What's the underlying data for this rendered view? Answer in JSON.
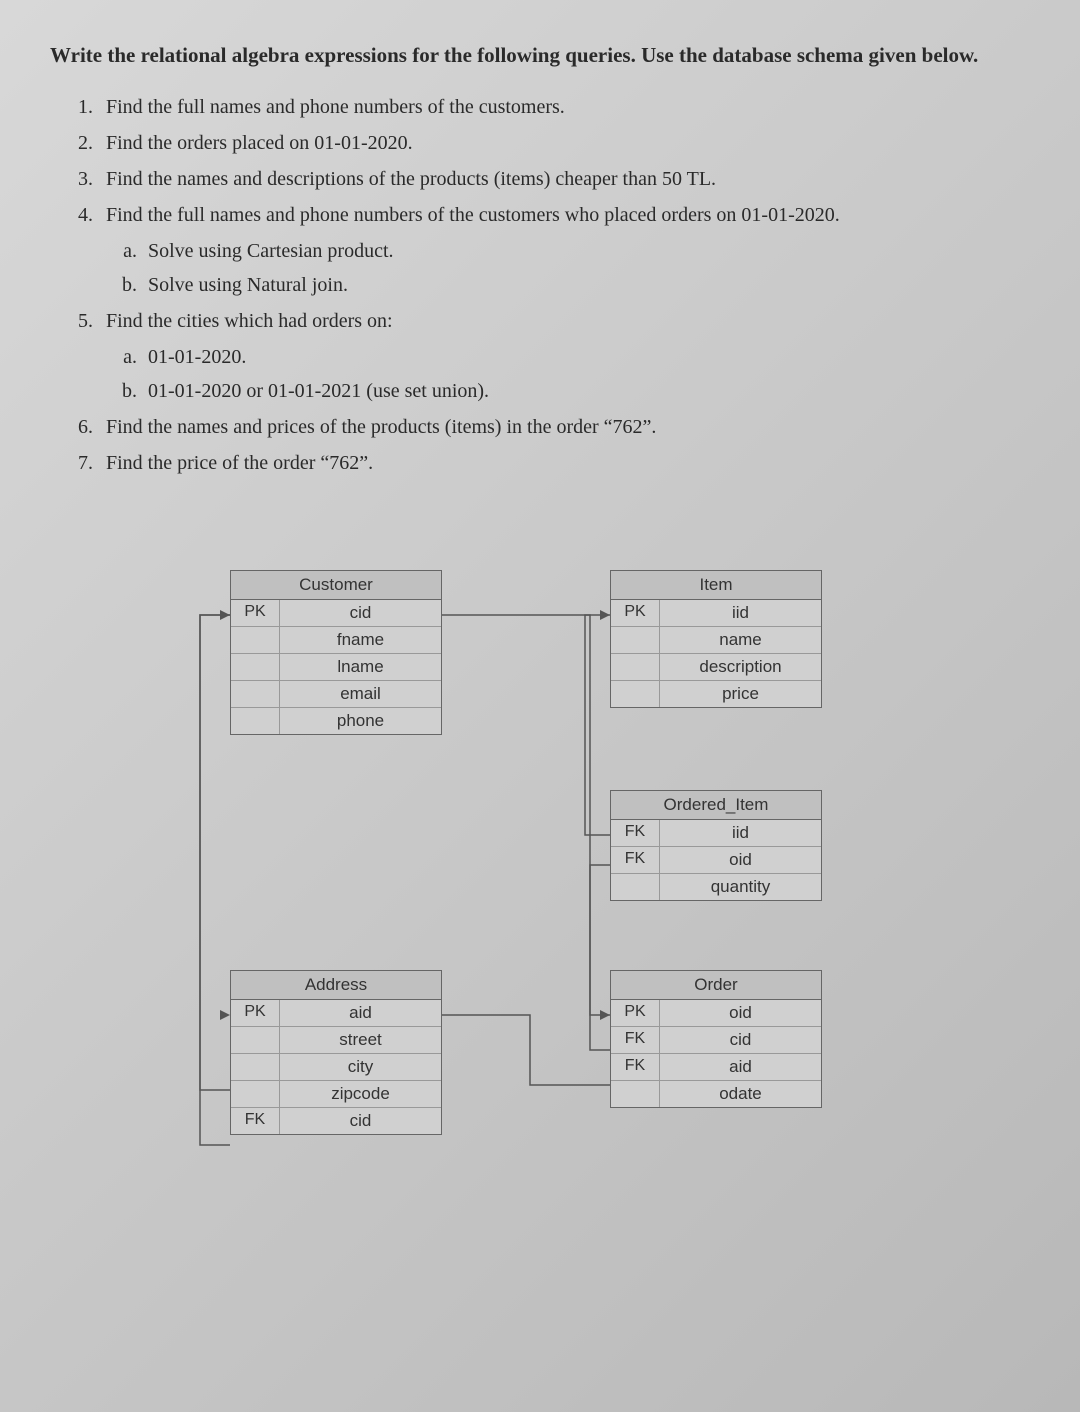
{
  "title": "Write the relational algebra expressions for the following queries. Use the database schema given below.",
  "questions": [
    "Find the full names and phone numbers of the customers.",
    "Find the orders placed on 01-01-2020.",
    "Find the names and descriptions of the products (items) cheaper than 50 TL.",
    "Find the full names and phone numbers of the customers who placed orders on 01-01-2020.",
    "Find the cities which had orders on:",
    "Find the names and prices of the products (items) in the order “762”.",
    "Find the price of the order “762”."
  ],
  "sub4": [
    "Solve using Cartesian product.",
    "Solve using Natural join."
  ],
  "sub5": [
    "01-01-2020.",
    "01-01-2020 or 01-01-2021 (use set union)."
  ],
  "tables": {
    "customer": {
      "name": "Customer",
      "rows": [
        {
          "key": "PK",
          "attr": "cid"
        },
        {
          "key": "",
          "attr": "fname"
        },
        {
          "key": "",
          "attr": "lname"
        },
        {
          "key": "",
          "attr": "email"
        },
        {
          "key": "",
          "attr": "phone"
        }
      ]
    },
    "item": {
      "name": "Item",
      "rows": [
        {
          "key": "PK",
          "attr": "iid"
        },
        {
          "key": "",
          "attr": "name"
        },
        {
          "key": "",
          "attr": "description"
        },
        {
          "key": "",
          "attr": "price"
        }
      ]
    },
    "ordered": {
      "name": "Ordered_Item",
      "rows": [
        {
          "key": "FK",
          "attr": "iid"
        },
        {
          "key": "FK",
          "attr": "oid"
        },
        {
          "key": "",
          "attr": "quantity"
        }
      ]
    },
    "address": {
      "name": "Address",
      "rows": [
        {
          "key": "PK",
          "attr": "aid"
        },
        {
          "key": "",
          "attr": "street"
        },
        {
          "key": "",
          "attr": "city"
        },
        {
          "key": "",
          "attr": "zipcode"
        },
        {
          "key": "FK",
          "attr": "cid"
        }
      ]
    },
    "order": {
      "name": "Order",
      "rows": [
        {
          "key": "PK",
          "attr": "oid"
        },
        {
          "key": "FK",
          "attr": "cid"
        },
        {
          "key": "FK",
          "attr": "aid"
        },
        {
          "key": "",
          "attr": "odate"
        }
      ]
    }
  }
}
